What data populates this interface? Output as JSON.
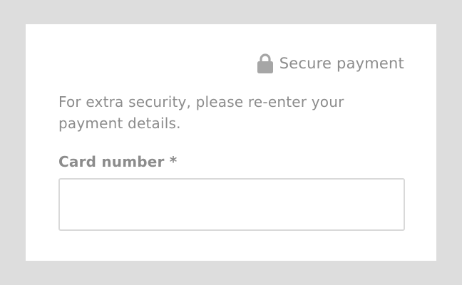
{
  "secure_badge": {
    "icon": "lock-icon",
    "label": "Secure payment"
  },
  "intro_text": "For extra security, please re-enter your payment details.",
  "card_number": {
    "label": "Card number *",
    "value": "",
    "placeholder": ""
  },
  "colors": {
    "page_background": "#dddddd",
    "panel_background": "#ffffff",
    "text": "#8c8c8c",
    "input_border": "#d9d9d9"
  }
}
